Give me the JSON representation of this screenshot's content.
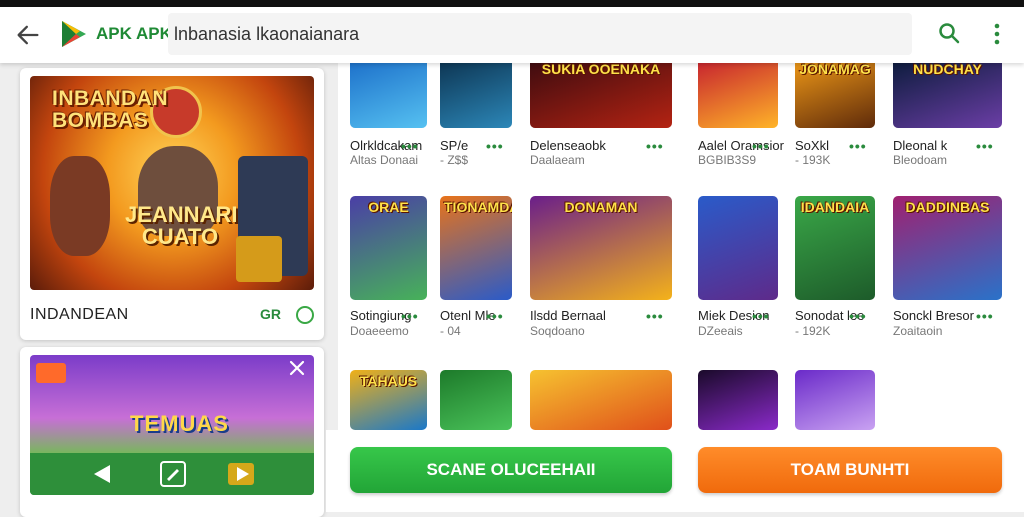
{
  "colors": {
    "accent": "#2a8b3d",
    "primary_button": "#22a537",
    "secondary_button": "#f06a0c"
  },
  "header": {
    "brand": "APK APK",
    "search_text": "lnbanasia lkaonaianara",
    "back_icon": "arrow-left-icon",
    "search_icon": "search-icon",
    "menu_icon": "more-vert-icon"
  },
  "featured": {
    "art_title": "INBANDAN BOMBAS",
    "art_sub": "JEANNARI CUATO",
    "title": "INDANDEAN",
    "rating": "GR"
  },
  "promo": {
    "art_title": "TEMUAS"
  },
  "apps": [
    {
      "name": "Olrkldcakam",
      "dev": "Altas Donaai",
      "art": ""
    },
    {
      "name": "SP/e",
      "dev": "- Z$$",
      "art": ""
    },
    {
      "name": "Delenseaobk",
      "dev": "Daalaeam",
      "art": "SUKIA OOENAKA"
    },
    {
      "name": "Aalel Oramsior",
      "dev": "BGBIB3S9",
      "art": ""
    },
    {
      "name": "SoXkl",
      "dev": "- 193K",
      "art": "JONAMAG"
    },
    {
      "name": "Dleonal k",
      "dev": "Bleodoam",
      "art": "NUDCHAY"
    },
    {
      "name": "Sotingiung",
      "dev": "Doaeeemo",
      "art": "ORAE"
    },
    {
      "name": "Otenl Mle",
      "dev": "- 04",
      "art": "TIONAMDA"
    },
    {
      "name": "Ilsdd Bernaal",
      "dev": "Soqdoano",
      "art": "DONAMAN"
    },
    {
      "name": "Miek Desion",
      "dev": "DZeeais",
      "art": ""
    },
    {
      "name": "Sonodat lee",
      "dev": "- 192K",
      "art": "IDANDAIA"
    },
    {
      "name": "Sonckl Bresor",
      "dev": "Zoaitaoin",
      "art": "DADDINBAS"
    },
    {
      "name": "",
      "dev": "",
      "art": "TAHAUS"
    },
    {
      "name": "",
      "dev": "",
      "art": ""
    },
    {
      "name": "",
      "dev": "",
      "art": ""
    },
    {
      "name": "",
      "dev": "",
      "art": ""
    },
    {
      "name": "",
      "dev": "",
      "art": ""
    }
  ],
  "buttons": {
    "primary": "SCANE OLUCEEHAII",
    "secondary": "TOAM BUNHTI"
  }
}
